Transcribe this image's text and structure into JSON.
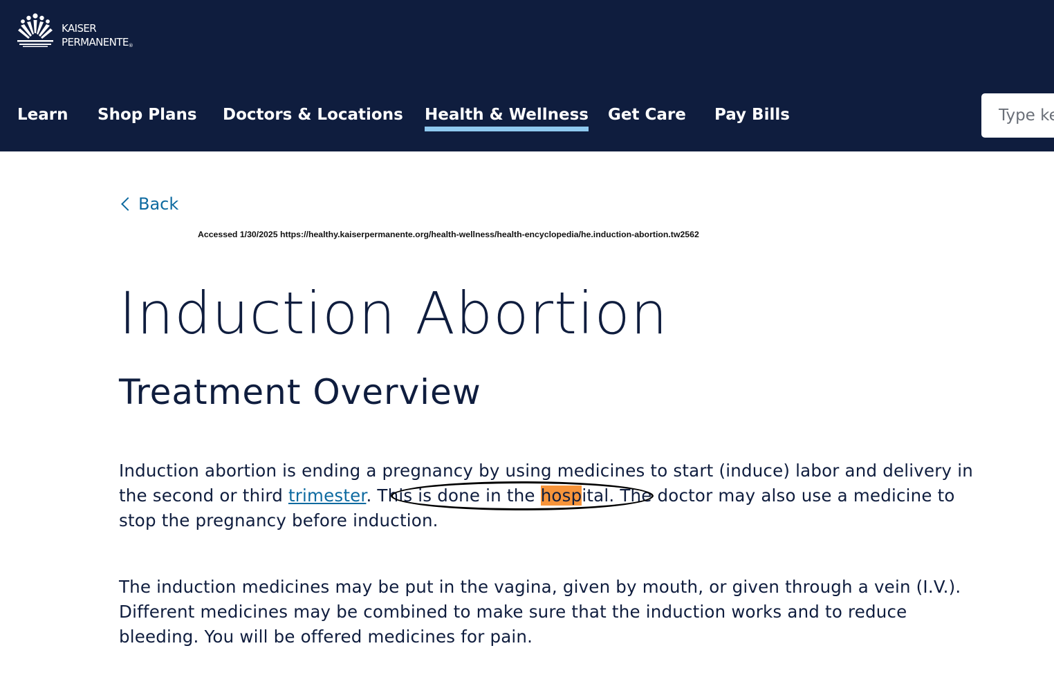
{
  "brand": {
    "name_line1": "KAISER",
    "name_line2": "PERMANENTE",
    "registered_mark": "®",
    "logo_icon": "kaiser-sunburst-logo-icon"
  },
  "nav": {
    "items": [
      {
        "label": "Learn"
      },
      {
        "label": "Shop Plans"
      },
      {
        "label": "Doctors & Locations"
      },
      {
        "label": "Health & Wellness",
        "active": true
      },
      {
        "label": "Get Care"
      },
      {
        "label": "Pay Bills"
      }
    ],
    "active_underline_color": "#8fc9ef"
  },
  "search": {
    "placeholder": "Type keywords"
  },
  "back": {
    "label": "Back",
    "icon": "chevron-left-icon"
  },
  "accessed_note": "Accessed 1/30/2025 https://healthy.kaiserpermanente.org/health-wellness/health-encyclopedia/he.induction-abortion.tw2562",
  "page": {
    "title": "Induction Abortion",
    "section_title": "Treatment Overview"
  },
  "paragraph1": {
    "line1": "Induction abortion is ending a pregnancy by using medicines to start (induce) labor and delivery in",
    "line2_prefix": "the second or third ",
    "link_text": "trimester",
    "line2_period": ".",
    "circled_prefix": " This is done in the ",
    "highlighted": "hosp",
    "circled_suffix": "ital.",
    "line2_rest": " The doctor may also use a medicine to",
    "line3": "stop the pregnancy before induction."
  },
  "paragraph2": {
    "line1": "The induction medicines may be put in the vagina, given by mouth, or given through a vein (I.V.).",
    "line2": "Different medicines may be combined to make sure that the induction works and to reduce",
    "line3": "bleeding. You will be offered medicines for pain."
  },
  "colors": {
    "header_bg": "#0f1d3e",
    "link": "#0d6aa0",
    "highlight": "#f7943a",
    "text": "#0f1d3e"
  }
}
